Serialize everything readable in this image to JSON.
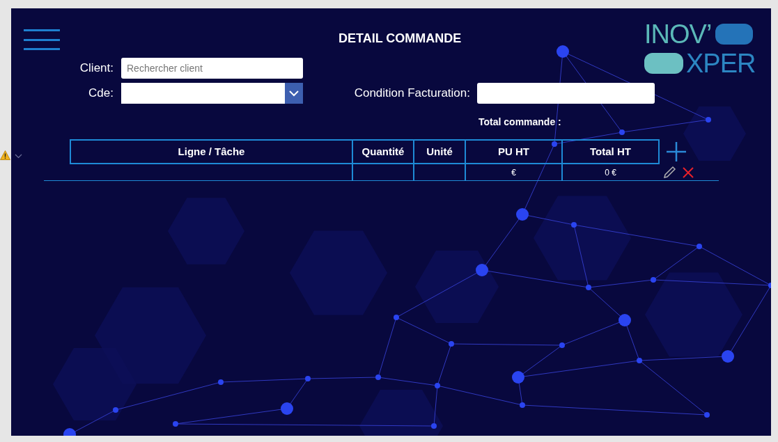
{
  "header": {
    "title": "DETAIL COMMANDE"
  },
  "logo": {
    "line_1": "INOV’",
    "line_2": "XPER"
  },
  "form": {
    "client": {
      "label": "Client:",
      "placeholder": "Rechercher client"
    },
    "order": {
      "label": "Cde:"
    },
    "billing": {
      "label": "Condition Facturation:"
    },
    "total": {
      "label": "Total commande :"
    }
  },
  "table": {
    "columns": [
      "Ligne / Tâche",
      "Quantité",
      "Unité",
      "PU HT",
      "Total HT"
    ],
    "rows": [
      {
        "pu_ht": "€",
        "total_ht": "0 €"
      }
    ]
  }
}
